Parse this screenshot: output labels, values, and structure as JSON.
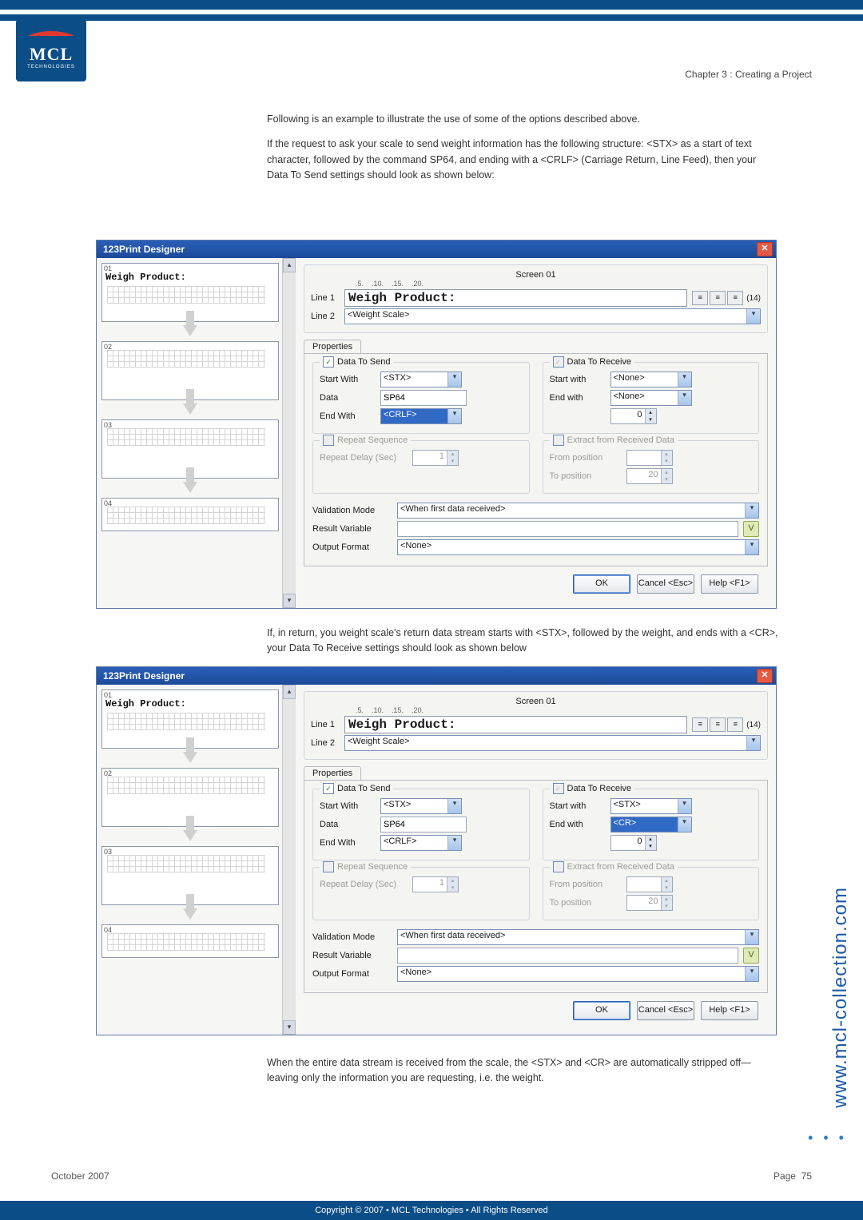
{
  "header": {
    "chapter": "Chapter 3 : Creating a Project",
    "logo_main": "MCL",
    "logo_sub": "TECHNOLOGIES"
  },
  "body": {
    "p1": "Following is an example to illustrate the use of some of the options described above.",
    "p2": "If the request to ask your scale to send weight information has the following structure: <STX> as a start of text character, followed by the command SP64, and ending with a <CRLF> (Carriage Return, Line Feed), then your Data To Send settings should look as shown below:",
    "p3": "If, in return, you weight scale's return data stream starts with <STX>, followed by the weight, and ends with a <CR>, your Data To Receive settings should look as shown below",
    "p4": "When the entire data stream is received from the scale, the <STX> and <CR> are automatically stripped off—leaving only the information you are requesting, i.e. the weight."
  },
  "dialog": {
    "title": "123Print Designer",
    "close": "✕",
    "screens": {
      "s1": "01",
      "s2": "02",
      "s3": "03",
      "s4": "04",
      "s1_title": "Weigh Product:"
    },
    "screen_legend": "Screen 01",
    "ruler": "    .5.    .10.    .15.    .20.",
    "line1_lbl": "Line 1",
    "line1_val": "Weigh Product:",
    "font_size": "(14)",
    "line2_lbl": "Line 2",
    "line2_val": "<Weight Scale>",
    "tab": "Properties",
    "send": {
      "title": "Data To Send",
      "start_lbl": "Start With",
      "start_v1": "<STX>",
      "data_lbl": "Data",
      "data_v1": "SP64",
      "end_lbl": "End With",
      "end_v1": "<CRLF>"
    },
    "recv": {
      "title": "Data To Receive",
      "start_lbl": "Start with",
      "start_none": "<None>",
      "start_stx": "<STX>",
      "end_lbl": "End with",
      "end_none": "<None>",
      "end_cr": "<CR>",
      "len_v": "0"
    },
    "repeat": {
      "title": "Repeat Sequence",
      "delay_lbl": "Repeat Delay (Sec)",
      "delay_v": "1"
    },
    "extract": {
      "title": "Extract from Received Data",
      "from_lbl": "From position",
      "to_lbl": "To position",
      "to_v": "20"
    },
    "valid_lbl": "Validation Mode",
    "valid_v": "<When first data received>",
    "resvar_lbl": "Result Variable",
    "outfmt_lbl": "Output Format",
    "outfmt_v": "<None>",
    "ok": "OK",
    "cancel": "Cancel <Esc>",
    "help": "Help <F1>"
  },
  "side_url": "www.mcl-collection.com",
  "footer": {
    "date": "October 2007",
    "page_lbl": "Page",
    "page_no": "75"
  },
  "copyright": "Copyright © 2007 • MCL Technologies • All Rights Reserved"
}
